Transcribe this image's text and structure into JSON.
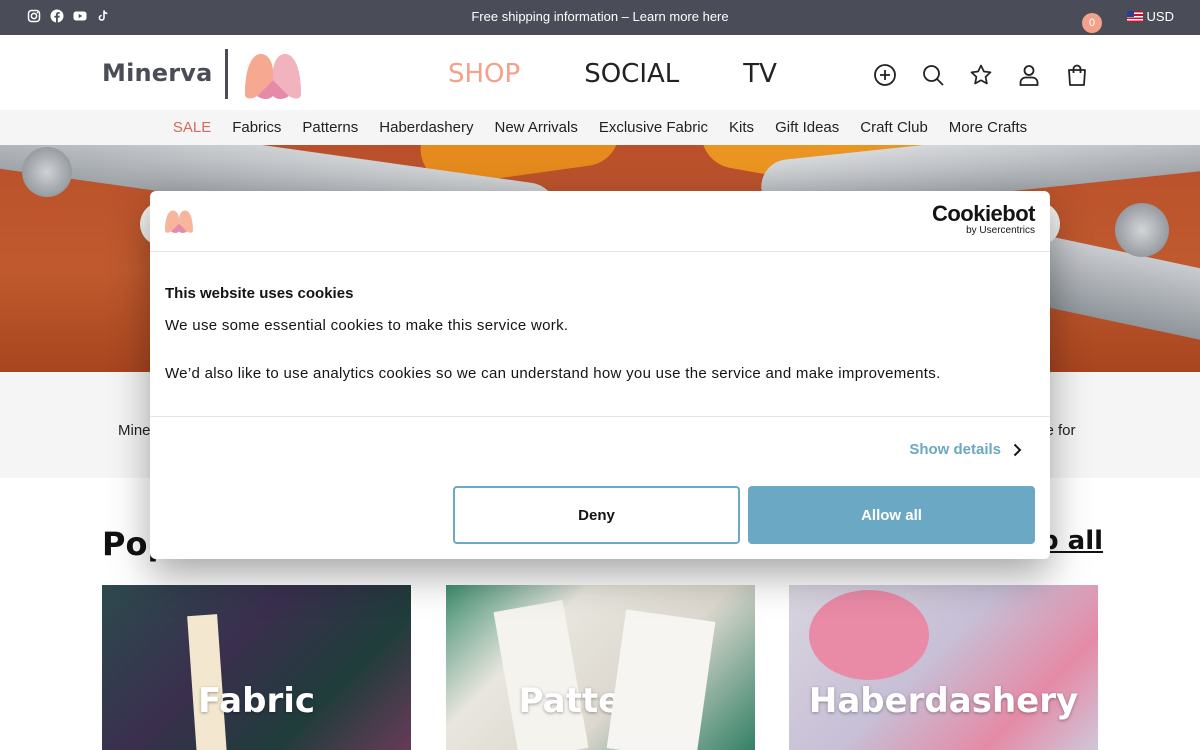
{
  "topbar": {
    "social_icons": [
      "instagram-icon",
      "facebook-icon",
      "youtube-icon",
      "tiktok-icon"
    ],
    "shipping_text": "Free shipping information – Learn more here",
    "currency": "USD"
  },
  "header": {
    "logo_text": "Minerva",
    "nav": [
      "SHOP",
      "SOCIAL",
      "TV"
    ],
    "icons": [
      "add-circle-icon",
      "search-icon",
      "star-icon",
      "user-icon",
      "bag-icon"
    ],
    "cart_count": "0"
  },
  "subnav": {
    "items": [
      "SALE",
      "Fabrics",
      "Patterns",
      "Haberdashery",
      "New Arrivals",
      "Exclusive Fabric",
      "Kits",
      "Gift Ideas",
      "Craft Club",
      "More Crafts"
    ]
  },
  "intro": {
    "left_fragment": "Mine",
    "right_fragment": "ce for"
  },
  "popular": {
    "title_left": "Pop",
    "title_right": "p all",
    "cards": [
      "Fabric",
      "Patterns",
      "Haberdashery"
    ]
  },
  "cookie": {
    "brand": "Cookiebot",
    "brand_sub": "by Usercentrics",
    "title": "This website uses cookies",
    "paragraph1": "We use some essential cookies to make this service work.",
    "paragraph2": "We’d also like to use analytics cookies so we can understand how you use the service and make improvements.",
    "show_details": "Show details",
    "deny": "Deny",
    "allow_all": "Allow all"
  },
  "colors": {
    "topbar_bg": "#4a4d57",
    "accent_pink": "#f4a18c",
    "sale_red": "#d46a5c",
    "cookie_blue": "#6aa8c4"
  }
}
